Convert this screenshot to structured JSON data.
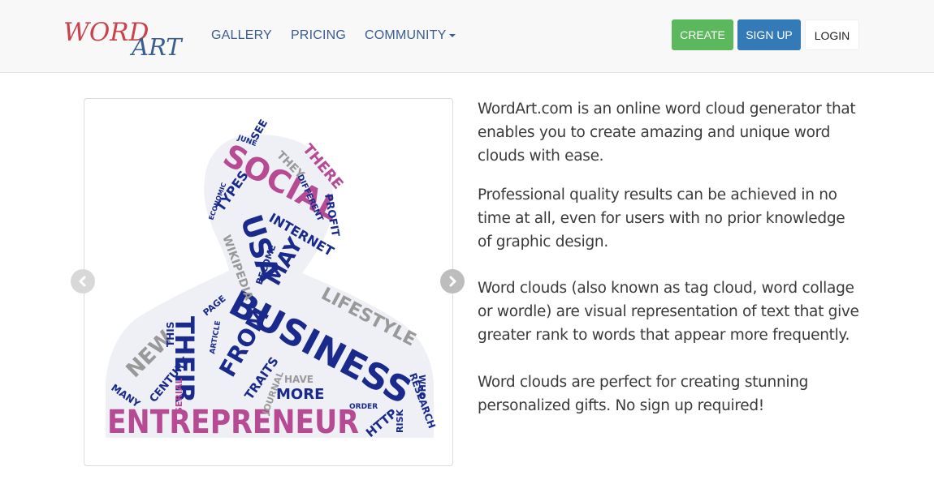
{
  "brand": {
    "logo_text_1": "WORD",
    "logo_text_2": "ART",
    "color_red": "#c8434b",
    "color_blue": "#3a5d8f"
  },
  "nav": {
    "gallery": "GALLERY",
    "pricing": "PRICING",
    "community": "COMMUNITY"
  },
  "buttons": {
    "create": "CREATE",
    "signup": "SIGN UP",
    "login": "LOGIN",
    "create_color": "#5cb85c",
    "signup_color": "#337ab7"
  },
  "carousel": {
    "image_alt": "Word cloud shaped like a person",
    "words": {
      "entrepreneur": "ENTREPRENEUR",
      "business": "BUSINESS",
      "social": "SOCIAL",
      "usa": "USA",
      "their": "THEIR",
      "from": "FROM",
      "may": "MAY",
      "more": "MORE",
      "internet": "INTERNET",
      "lifestyle": "LIFESTYLE",
      "new": "NEW",
      "there": "THERE",
      "profit": "PROFIT",
      "types": "TYPES",
      "traits": "TRAITS",
      "century": "CENTURY",
      "research": "RESEARCH",
      "wikipedia": "WIKIPEDIA",
      "become": "BECOME",
      "different": "DIFFERENT",
      "http": "HTTP",
      "page": "PAGE",
      "journal": "JOURNAL",
      "have": "HAVE",
      "many": "MANY",
      "risk": "RISK",
      "see": "SEE",
      "june": "JUNE",
      "they": "THEY",
      "serial": "SERIAL",
      "this": "THIS",
      "who": "WHO",
      "economic": "ECONOMIC",
      "order": "ORDER",
      "article": "ARTICLE"
    }
  },
  "intro": {
    "p1": "WordArt.com is an online word cloud generator that enables you to create amazing and unique word clouds with ease.",
    "p2": "Professional quality results can be achieved in no time at all, even for users with no prior knowledge of graphic design.",
    "p3": "Word clouds (also known as tag cloud, word collage or wordle) are visual representation of text that give greater rank to words that appear more frequently.",
    "p4": "Word clouds are perfect for creating stunning personalized gifts. No sign up required!"
  }
}
